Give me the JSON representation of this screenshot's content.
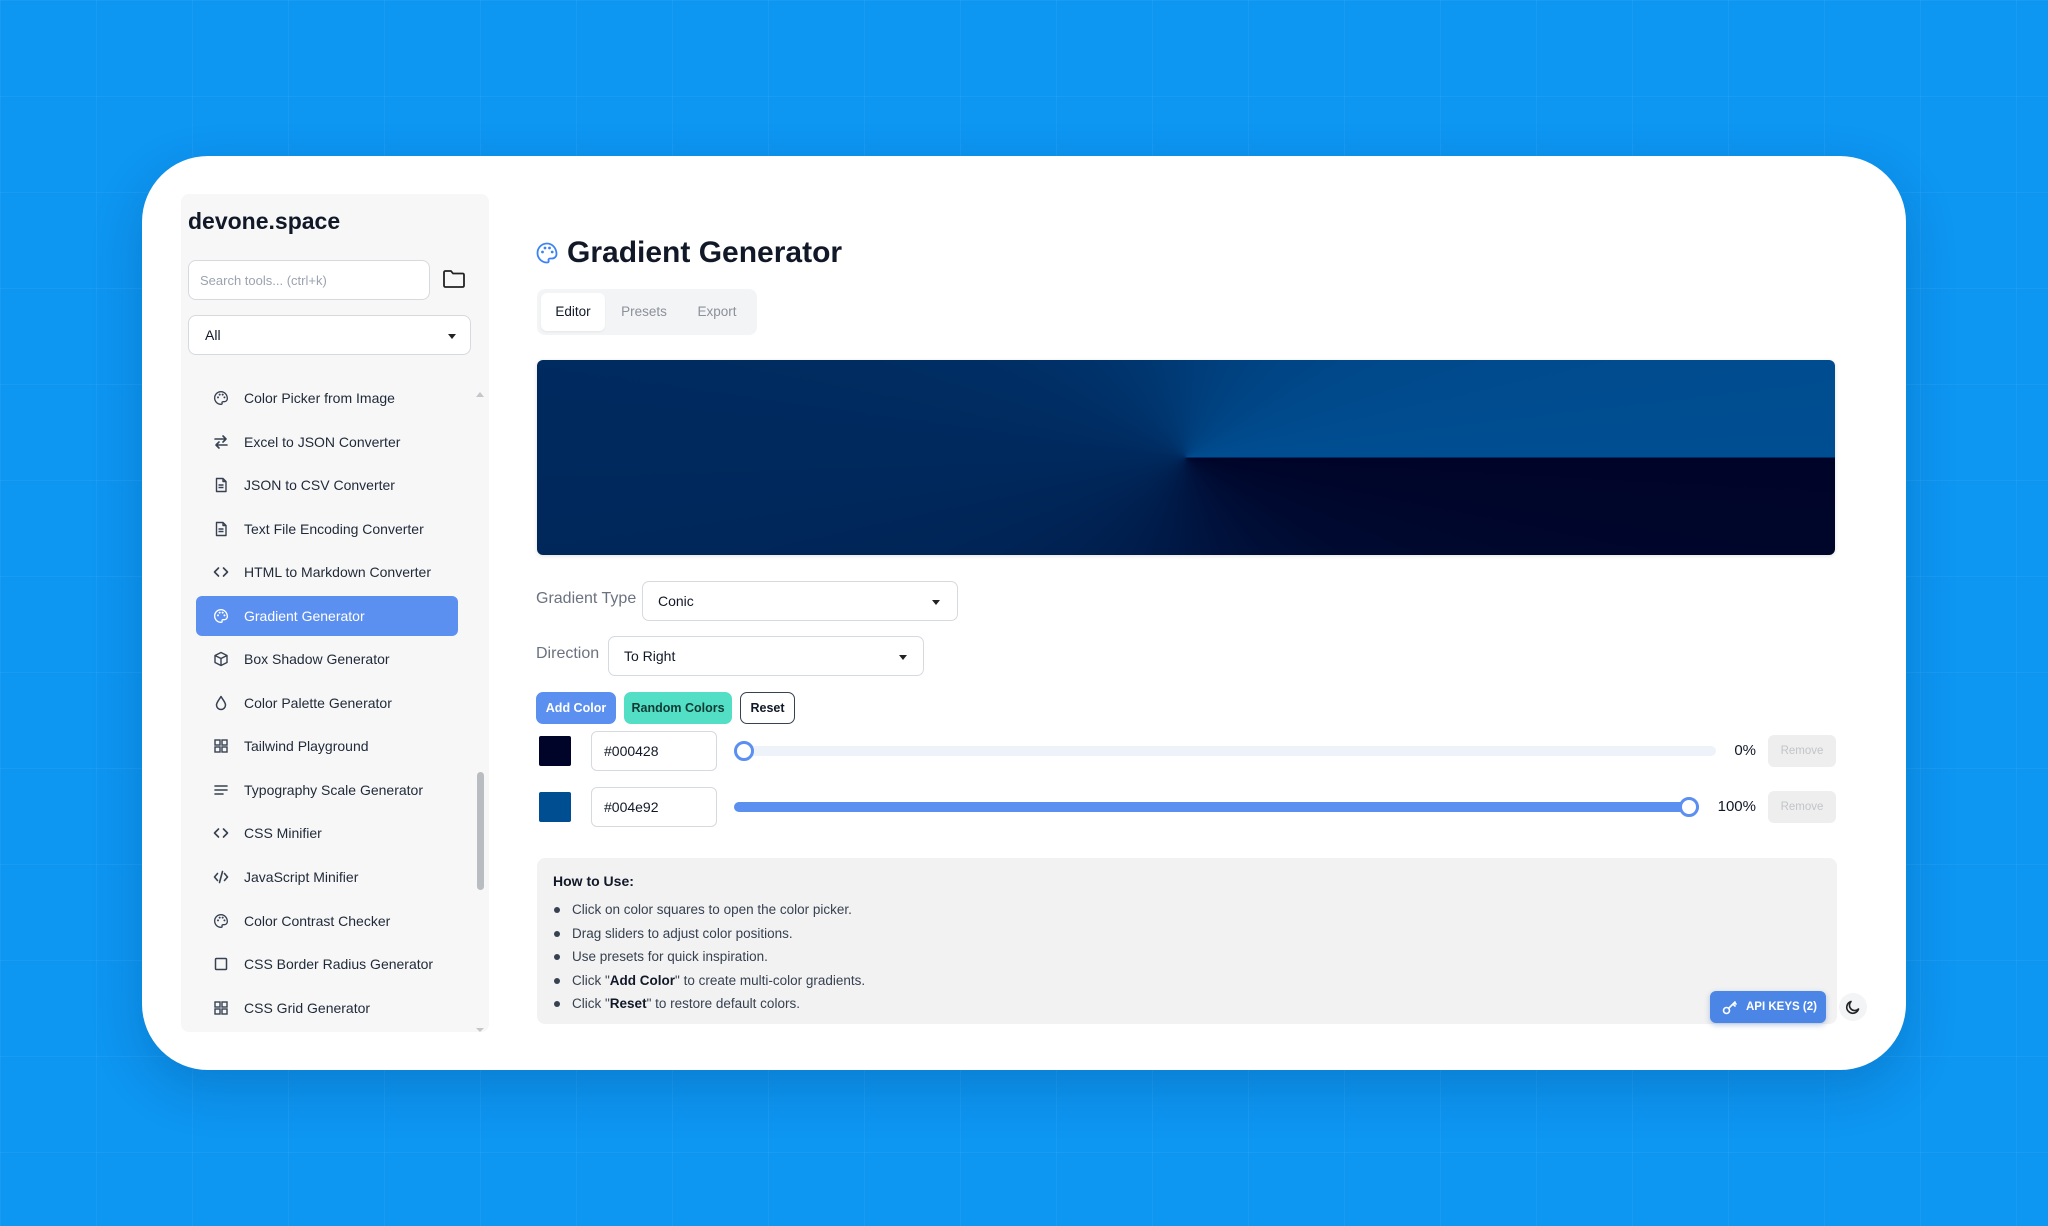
{
  "brand": "devone.space",
  "search": {
    "placeholder": "Search tools... (ctrl+k)"
  },
  "category": {
    "selected": "All"
  },
  "nav": {
    "items": [
      {
        "label": "Color Picker from Image",
        "icon": "palette-icon",
        "active": false
      },
      {
        "label": "Excel to JSON Converter",
        "icon": "arrows-exchange-icon",
        "active": false
      },
      {
        "label": "JSON to CSV Converter",
        "icon": "file-text-icon",
        "active": false
      },
      {
        "label": "Text File Encoding Converter",
        "icon": "file-text-icon",
        "active": false
      },
      {
        "label": "HTML to Markdown Converter",
        "icon": "code-icon",
        "active": false
      },
      {
        "label": "Gradient Generator",
        "icon": "palette-icon",
        "active": true
      },
      {
        "label": "Box Shadow Generator",
        "icon": "box-icon",
        "active": false
      },
      {
        "label": "Color Palette Generator",
        "icon": "droplet-icon",
        "active": false
      },
      {
        "label": "Tailwind Playground",
        "icon": "grid-icon",
        "active": false
      },
      {
        "label": "Typography Scale Generator",
        "icon": "lines-icon",
        "active": false
      },
      {
        "label": "CSS Minifier",
        "icon": "code-icon",
        "active": false
      },
      {
        "label": "JavaScript Minifier",
        "icon": "code-slash-icon",
        "active": false
      },
      {
        "label": "Color Contrast Checker",
        "icon": "palette-icon",
        "active": false
      },
      {
        "label": "CSS Border Radius Generator",
        "icon": "square-icon",
        "active": false
      },
      {
        "label": "CSS Grid Generator",
        "icon": "grid-icon",
        "active": false
      }
    ]
  },
  "main": {
    "title": "Gradient Generator",
    "tabs": [
      {
        "label": "Editor",
        "active": true
      },
      {
        "label": "Presets",
        "active": false
      },
      {
        "label": "Export",
        "active": false
      }
    ],
    "gradient_type_label": "Gradient Type",
    "gradient_type_value": "Conic",
    "direction_label": "Direction",
    "direction_value": "To Right",
    "buttons": {
      "add": "Add Color",
      "random": "Random Colors",
      "reset": "Reset"
    },
    "stops": [
      {
        "color": "#000428",
        "hex": "#000428",
        "position": 0,
        "position_label": "0%",
        "remove": "Remove"
      },
      {
        "color": "#004e92",
        "hex": "#004e92",
        "position": 100,
        "position_label": "100%",
        "remove": "Remove"
      }
    ],
    "howto": {
      "title": "How to Use:",
      "items": [
        {
          "pre": "Click on color squares to open the color picker.",
          "bold": "",
          "post": ""
        },
        {
          "pre": "Drag sliders to adjust color positions.",
          "bold": "",
          "post": ""
        },
        {
          "pre": "Use presets for quick inspiration.",
          "bold": "",
          "post": ""
        },
        {
          "pre": "Click \"",
          "bold": "Add Color",
          "post": "\" to create multi-color gradients."
        },
        {
          "pre": "Click \"",
          "bold": "Reset",
          "post": "\" to restore default colors."
        }
      ]
    }
  },
  "api_keys": {
    "label": "API KEYS (2)"
  },
  "colors": {
    "background": "#0d96f2",
    "accent": "#5b8ff0",
    "random_button": "#53dfc5"
  }
}
